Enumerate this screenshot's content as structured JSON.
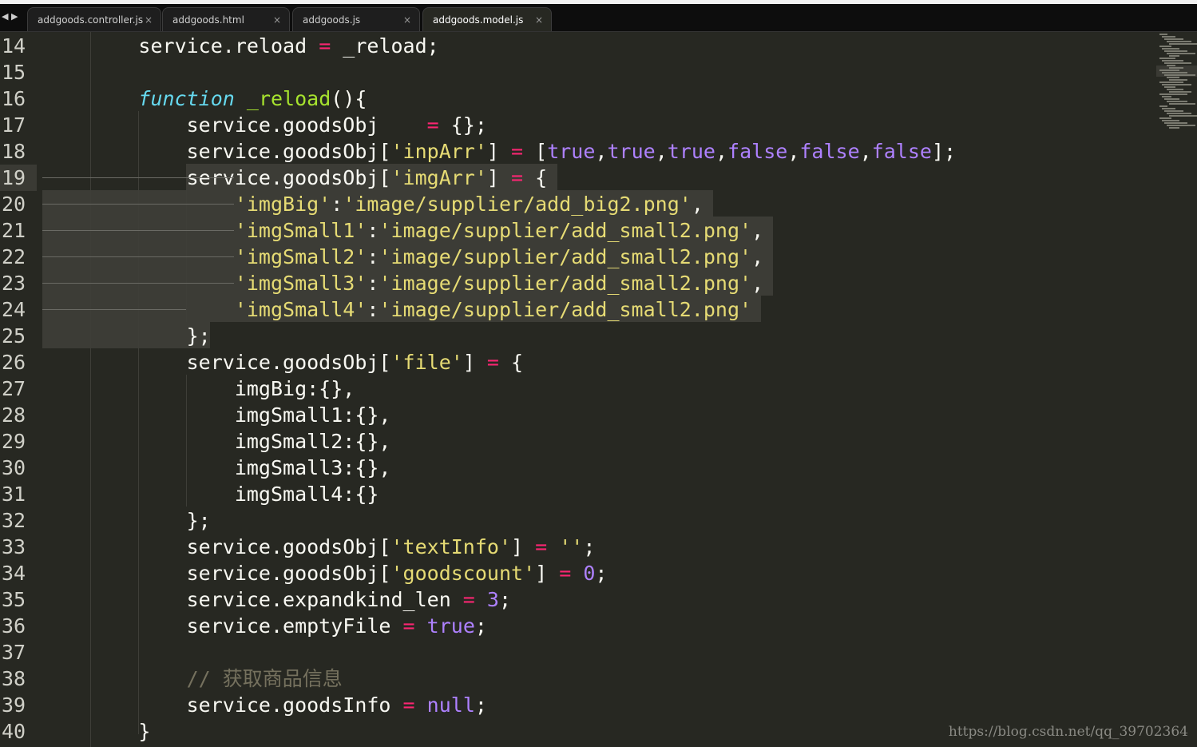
{
  "tabs": [
    {
      "label": "addgoods.controller.js",
      "close": "×",
      "active": false
    },
    {
      "label": "addgoods.html",
      "close": "×",
      "active": false
    },
    {
      "label": "addgoods.js",
      "close": "×",
      "active": false
    },
    {
      "label": "addgoods.model.js",
      "close": "×",
      "active": true
    }
  ],
  "tab_nav": "◀ ▶",
  "current_line": 19,
  "lines": [
    {
      "n": "14",
      "code": [
        [
          "pl",
          "        service.reload "
        ],
        [
          "op",
          "="
        ],
        [
          "pl",
          " _reload;"
        ]
      ]
    },
    {
      "n": "15",
      "code": []
    },
    {
      "n": "16",
      "code": [
        [
          "pl",
          "        "
        ],
        [
          "kw",
          "function"
        ],
        [
          "pl",
          " "
        ],
        [
          "fn",
          "_reload"
        ],
        [
          "pl",
          "(){"
        ]
      ]
    },
    {
      "n": "17",
      "code": [
        [
          "pl",
          "            service.goodsObj    "
        ],
        [
          "op",
          "="
        ],
        [
          "pl",
          " {};"
        ]
      ]
    },
    {
      "n": "18",
      "code": [
        [
          "pl",
          "            service.goodsObj["
        ],
        [
          "st",
          "'inpArr'"
        ],
        [
          "pl",
          "] "
        ],
        [
          "op",
          "="
        ],
        [
          "pl",
          " ["
        ],
        [
          "nb",
          "true"
        ],
        [
          "pl",
          ","
        ],
        [
          "nb",
          "true"
        ],
        [
          "pl",
          ","
        ],
        [
          "nb",
          "true"
        ],
        [
          "pl",
          ","
        ],
        [
          "nb",
          "false"
        ],
        [
          "pl",
          ","
        ],
        [
          "nb",
          "false"
        ],
        [
          "pl",
          ","
        ],
        [
          "nb",
          "false"
        ],
        [
          "pl",
          "];"
        ]
      ]
    },
    {
      "n": "19",
      "code": [
        [
          "pl",
          "            service.goodsObj["
        ],
        [
          "st",
          "'imgArr'"
        ],
        [
          "pl",
          "] "
        ],
        [
          "op",
          "="
        ],
        [
          "pl",
          " {"
        ]
      ]
    },
    {
      "n": "20",
      "code": [
        [
          "pl",
          "                "
        ],
        [
          "st",
          "'imgBig'"
        ],
        [
          "pl",
          ":"
        ],
        [
          "st",
          "'image/supplier/add_big2.png'"
        ],
        [
          "pl",
          ","
        ]
      ]
    },
    {
      "n": "21",
      "code": [
        [
          "pl",
          "                "
        ],
        [
          "st",
          "'imgSmall1'"
        ],
        [
          "pl",
          ":"
        ],
        [
          "st",
          "'image/supplier/add_small2.png'"
        ],
        [
          "pl",
          ","
        ]
      ]
    },
    {
      "n": "22",
      "code": [
        [
          "pl",
          "                "
        ],
        [
          "st",
          "'imgSmall2'"
        ],
        [
          "pl",
          ":"
        ],
        [
          "st",
          "'image/supplier/add_small2.png'"
        ],
        [
          "pl",
          ","
        ]
      ]
    },
    {
      "n": "23",
      "code": [
        [
          "pl",
          "                "
        ],
        [
          "st",
          "'imgSmall3'"
        ],
        [
          "pl",
          ":"
        ],
        [
          "st",
          "'image/supplier/add_small2.png'"
        ],
        [
          "pl",
          ","
        ]
      ]
    },
    {
      "n": "24",
      "code": [
        [
          "pl",
          "                "
        ],
        [
          "st",
          "'imgSmall4'"
        ],
        [
          "pl",
          ":"
        ],
        [
          "st",
          "'image/supplier/add_small2.png'"
        ]
      ]
    },
    {
      "n": "25",
      "code": [
        [
          "pl",
          "            };"
        ]
      ]
    },
    {
      "n": "26",
      "code": [
        [
          "pl",
          "            service.goodsObj["
        ],
        [
          "st",
          "'file'"
        ],
        [
          "pl",
          "] "
        ],
        [
          "op",
          "="
        ],
        [
          "pl",
          " {"
        ]
      ]
    },
    {
      "n": "27",
      "code": [
        [
          "pl",
          "                imgBig:{},"
        ]
      ]
    },
    {
      "n": "28",
      "code": [
        [
          "pl",
          "                imgSmall1:{},"
        ]
      ]
    },
    {
      "n": "29",
      "code": [
        [
          "pl",
          "                imgSmall2:{},"
        ]
      ]
    },
    {
      "n": "30",
      "code": [
        [
          "pl",
          "                imgSmall3:{},"
        ]
      ]
    },
    {
      "n": "31",
      "code": [
        [
          "pl",
          "                imgSmall4:{}"
        ]
      ]
    },
    {
      "n": "32",
      "code": [
        [
          "pl",
          "            };"
        ]
      ]
    },
    {
      "n": "33",
      "code": [
        [
          "pl",
          "            service.goodsObj["
        ],
        [
          "st",
          "'textInfo'"
        ],
        [
          "pl",
          "] "
        ],
        [
          "op",
          "="
        ],
        [
          "pl",
          " "
        ],
        [
          "st",
          "''"
        ],
        [
          "pl",
          ";"
        ]
      ]
    },
    {
      "n": "34",
      "code": [
        [
          "pl",
          "            service.goodsObj["
        ],
        [
          "st",
          "'goodscount'"
        ],
        [
          "pl",
          "] "
        ],
        [
          "op",
          "="
        ],
        [
          "pl",
          " "
        ],
        [
          "nb",
          "0"
        ],
        [
          "pl",
          ";"
        ]
      ]
    },
    {
      "n": "35",
      "code": [
        [
          "pl",
          "            service.expandkind_len "
        ],
        [
          "op",
          "="
        ],
        [
          "pl",
          " "
        ],
        [
          "nb",
          "3"
        ],
        [
          "pl",
          ";"
        ]
      ]
    },
    {
      "n": "36",
      "code": [
        [
          "pl",
          "            service.emptyFile "
        ],
        [
          "op",
          "="
        ],
        [
          "pl",
          " "
        ],
        [
          "nb",
          "true"
        ],
        [
          "pl",
          ";"
        ]
      ]
    },
    {
      "n": "37",
      "code": []
    },
    {
      "n": "38",
      "code": [
        [
          "pl",
          "            "
        ],
        [
          "cm",
          "// 获取商品信息"
        ]
      ]
    },
    {
      "n": "39",
      "code": [
        [
          "pl",
          "            service.goodsInfo "
        ],
        [
          "op",
          "="
        ],
        [
          "pl",
          " "
        ],
        [
          "nb",
          "null"
        ],
        [
          "pl",
          ";"
        ]
      ]
    },
    {
      "n": "40",
      "code": [
        [
          "pl",
          "        }"
        ]
      ]
    }
  ],
  "watermark": "https://blog.csdn.net/qq_39702364",
  "colors": {
    "background": "#272822",
    "plain": "#f8f8f2",
    "operator": "#f92672",
    "string": "#e6db74",
    "keyword": "#66d9ef",
    "function": "#a6e22e",
    "number": "#ae81ff",
    "comment": "#75715e"
  }
}
